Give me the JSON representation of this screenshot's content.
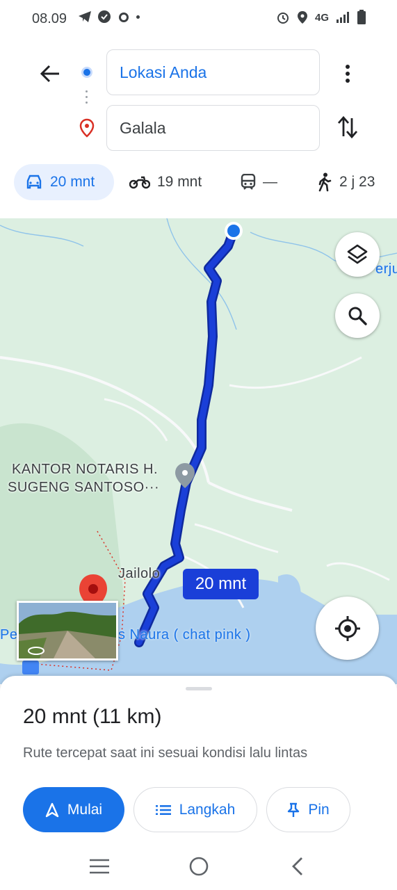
{
  "status_bar": {
    "time": "08.09",
    "network": "4G"
  },
  "directions": {
    "origin": "Lokasi Anda",
    "destination": "Galala"
  },
  "travel_modes": [
    {
      "mode": "car",
      "label": "20 mnt",
      "active": true
    },
    {
      "mode": "motorcycle",
      "label": "19 mnt"
    },
    {
      "mode": "transit",
      "label": "—"
    },
    {
      "mode": "walk",
      "label": "2 j 23"
    }
  ],
  "map": {
    "labels": {
      "notary": [
        "KANTOR NOTARIS H.",
        "SUGENG SANTOSO···"
      ],
      "town": "Jailolo",
      "poi_water": "Pel",
      "poi_shop": "s Naura ( chat pink )",
      "edge": "erju"
    },
    "route_time": "20 mnt",
    "colors": {
      "route": "#1a3fd8",
      "land": "#dcefe1",
      "water": "#aed0ef",
      "road": "#f8f9fa"
    }
  },
  "sheet": {
    "summary": "20 mnt (11 km)",
    "subtitle": "Rute tercepat saat ini sesuai kondisi lalu lintas",
    "buttons": {
      "start": "Mulai",
      "steps": "Langkah",
      "pin": "Pin"
    }
  },
  "icons": [
    "back-arrow-icon",
    "more-vert-icon",
    "swap-icon",
    "car-icon",
    "motorcycle-icon",
    "transit-icon",
    "walk-icon",
    "layers-icon",
    "search-icon",
    "my-location-icon",
    "navigation-icon",
    "list-icon",
    "pin-icon",
    "menu-icon",
    "home-circle-icon",
    "back-chevron-icon"
  ]
}
